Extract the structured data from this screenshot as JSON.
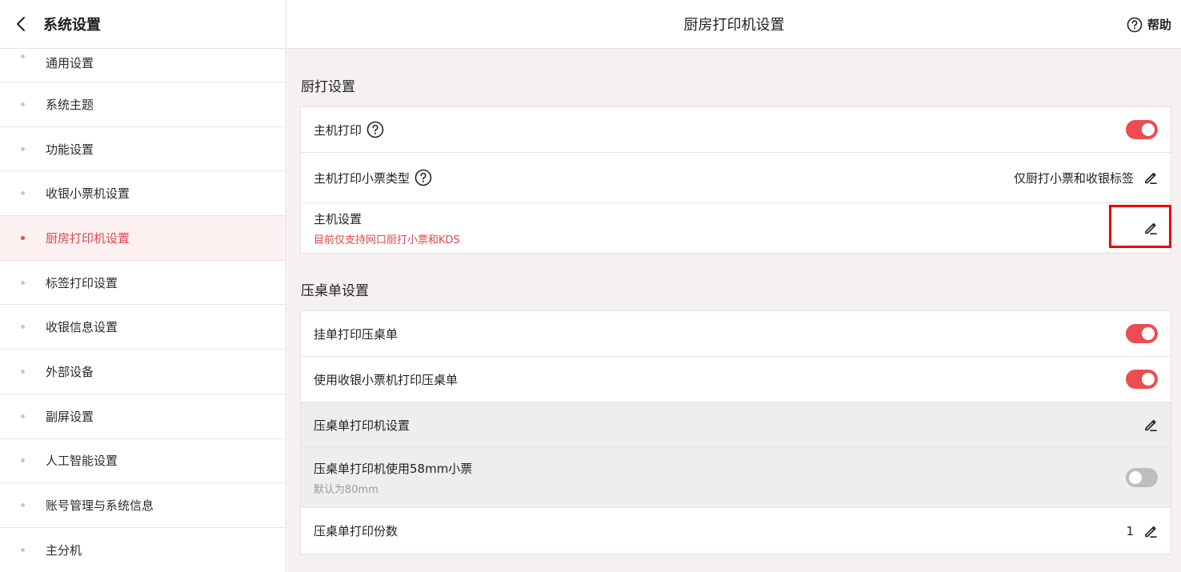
{
  "sidebar": {
    "title": "系统设置",
    "items": [
      {
        "label": "通用设置",
        "active": false
      },
      {
        "label": "系统主题",
        "active": false
      },
      {
        "label": "功能设置",
        "active": false
      },
      {
        "label": "收银小票机设置",
        "active": false
      },
      {
        "label": "厨房打印机设置",
        "active": true
      },
      {
        "label": "标签打印设置",
        "active": false
      },
      {
        "label": "收银信息设置",
        "active": false
      },
      {
        "label": "外部设备",
        "active": false
      },
      {
        "label": "副屏设置",
        "active": false
      },
      {
        "label": "人工智能设置",
        "active": false
      },
      {
        "label": "账号管理与系统信息",
        "active": false
      },
      {
        "label": "主分机",
        "active": false
      }
    ]
  },
  "header": {
    "title": "厨房打印机设置",
    "help_label": "帮助"
  },
  "kitchen": {
    "section_title": "厨打设置",
    "host_print": {
      "label": "主机打印",
      "enabled": true
    },
    "host_ticket_type": {
      "label": "主机打印小票类型",
      "value": "仅厨打小票和收银标签"
    },
    "host_settings": {
      "label": "主机设置",
      "note": "目前仅支持网口厨打小票和KDS"
    }
  },
  "table_slip": {
    "section_title": "压桌单设置",
    "hang_print": {
      "label": "挂单打印压桌单",
      "enabled": true
    },
    "use_receipt_printer": {
      "label": "使用收银小票机打印压桌单",
      "enabled": true
    },
    "printer_settings": {
      "label": "压桌单打印机设置"
    },
    "use_58mm": {
      "label": "压桌单打印机使用58mm小票",
      "note": "默认为80mm",
      "enabled": false
    },
    "copies": {
      "label": "压桌单打印份数",
      "value": "1"
    }
  },
  "colors": {
    "accent": "#ec4d52",
    "highlight": "#ee0000"
  }
}
